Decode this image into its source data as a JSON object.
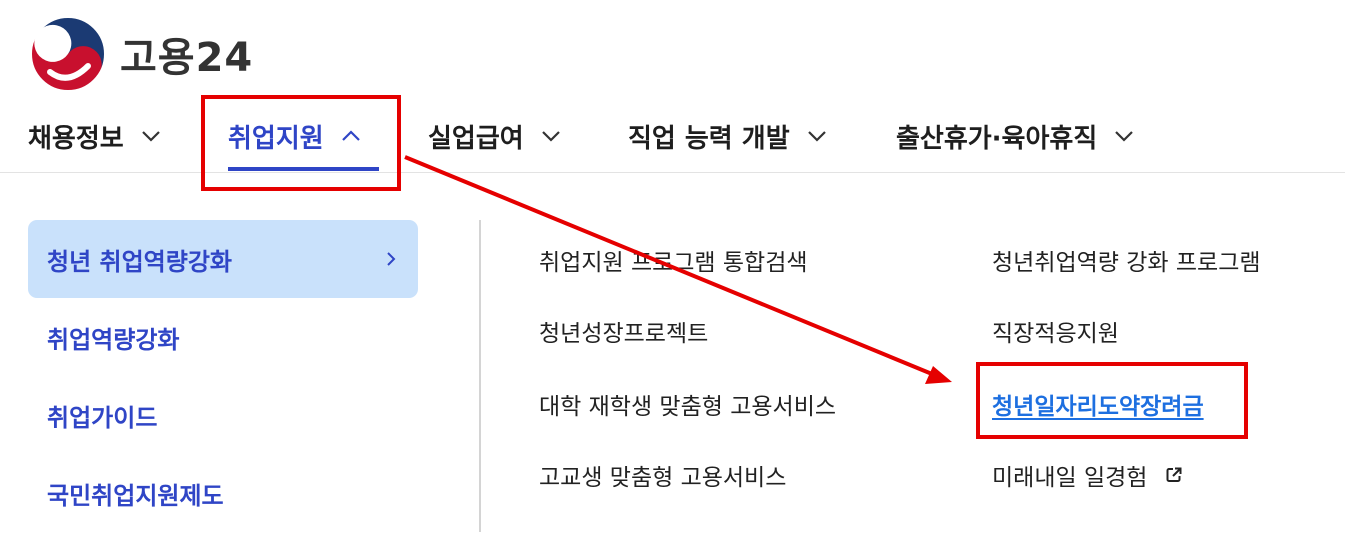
{
  "brand": {
    "logo_text": "고용24",
    "logo_icon": "taegeuk-emblem-icon"
  },
  "nav": {
    "items": [
      {
        "label": "채용정보",
        "icon": "chevron-down-icon"
      },
      {
        "label": "취업지원",
        "icon": "chevron-up-icon",
        "active": true
      },
      {
        "label": "실업급여",
        "icon": "chevron-down-icon"
      },
      {
        "label": "직업 능력 개발",
        "icon": "chevron-down-icon"
      },
      {
        "label": "출산휴가·육아휴직",
        "icon": "chevron-down-icon"
      }
    ]
  },
  "submenu": {
    "items": [
      {
        "label": "청년 취업역량강화",
        "active": true,
        "icon": "chevron-right-icon"
      },
      {
        "label": "취업역량강화"
      },
      {
        "label": "취업가이드"
      },
      {
        "label": "국민취업지원제도"
      }
    ]
  },
  "links": {
    "col1": [
      {
        "label": "취업지원 프로그램 통합검색"
      },
      {
        "label": "청년성장프로젝트"
      },
      {
        "label": "대학 재학생 맞춤형 고용서비스"
      },
      {
        "label": "고교생 맞춤형 고용서비스"
      }
    ],
    "col2": [
      {
        "label": "청년취업역량 강화 프로그램"
      },
      {
        "label": "직장적응지원"
      },
      {
        "label": "청년일자리도약장려금",
        "highlighted": true
      },
      {
        "label": "미래내일 일경험",
        "icon": "external-link-icon"
      }
    ]
  },
  "colors": {
    "accent": "#2f45c6",
    "submenu_active_bg": "#c9e1fb",
    "link_highlight": "#1d6fe0",
    "annotation_red": "#e50000"
  }
}
